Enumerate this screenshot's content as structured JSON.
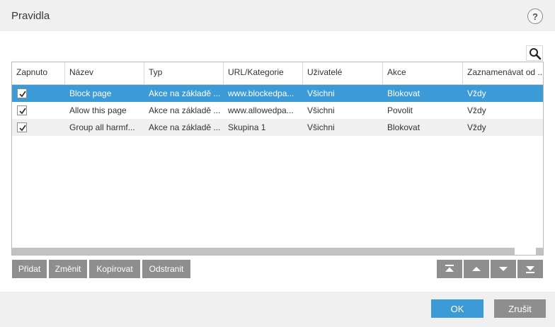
{
  "dialog": {
    "title": "Pravidla",
    "help_icon": "help-icon",
    "help_label": "?"
  },
  "toolbar": {
    "search_icon": "search-icon"
  },
  "table": {
    "columns": [
      "Zapnuto",
      "Název",
      "Typ",
      "URL/Kategorie",
      "Uživatelé",
      "Akce",
      "Zaznamenávat od ..."
    ],
    "rows": [
      {
        "enabled": true,
        "name": "Block page",
        "type": "Akce na základě ...",
        "url": "www.blockedpa...",
        "users": "Všichni",
        "action": "Blokovat",
        "log": "Vždy"
      },
      {
        "enabled": true,
        "name": "Allow this page",
        "type": "Akce na základě ...",
        "url": "www.allowedpa...",
        "users": "Všichni",
        "action": "Povolit",
        "log": "Vždy"
      },
      {
        "enabled": true,
        "name": "Group all harmf...",
        "type": "Akce na základě ...",
        "url": "Skupina 1",
        "users": "Všichni",
        "action": "Blokovat",
        "log": "Vždy"
      }
    ],
    "selected_row": 0
  },
  "actions": {
    "add": "Přidat",
    "edit": "Změnit",
    "copy": "Kopírovat",
    "remove": "Odstranit"
  },
  "move_buttons": [
    "move-to-top-icon",
    "move-up-icon",
    "move-down-icon",
    "move-to-bottom-icon"
  ],
  "footer": {
    "ok": "OK",
    "cancel": "Zrušit"
  },
  "colors": {
    "accent": "#3c9ad6",
    "button_gray": "#8e8e8e"
  }
}
